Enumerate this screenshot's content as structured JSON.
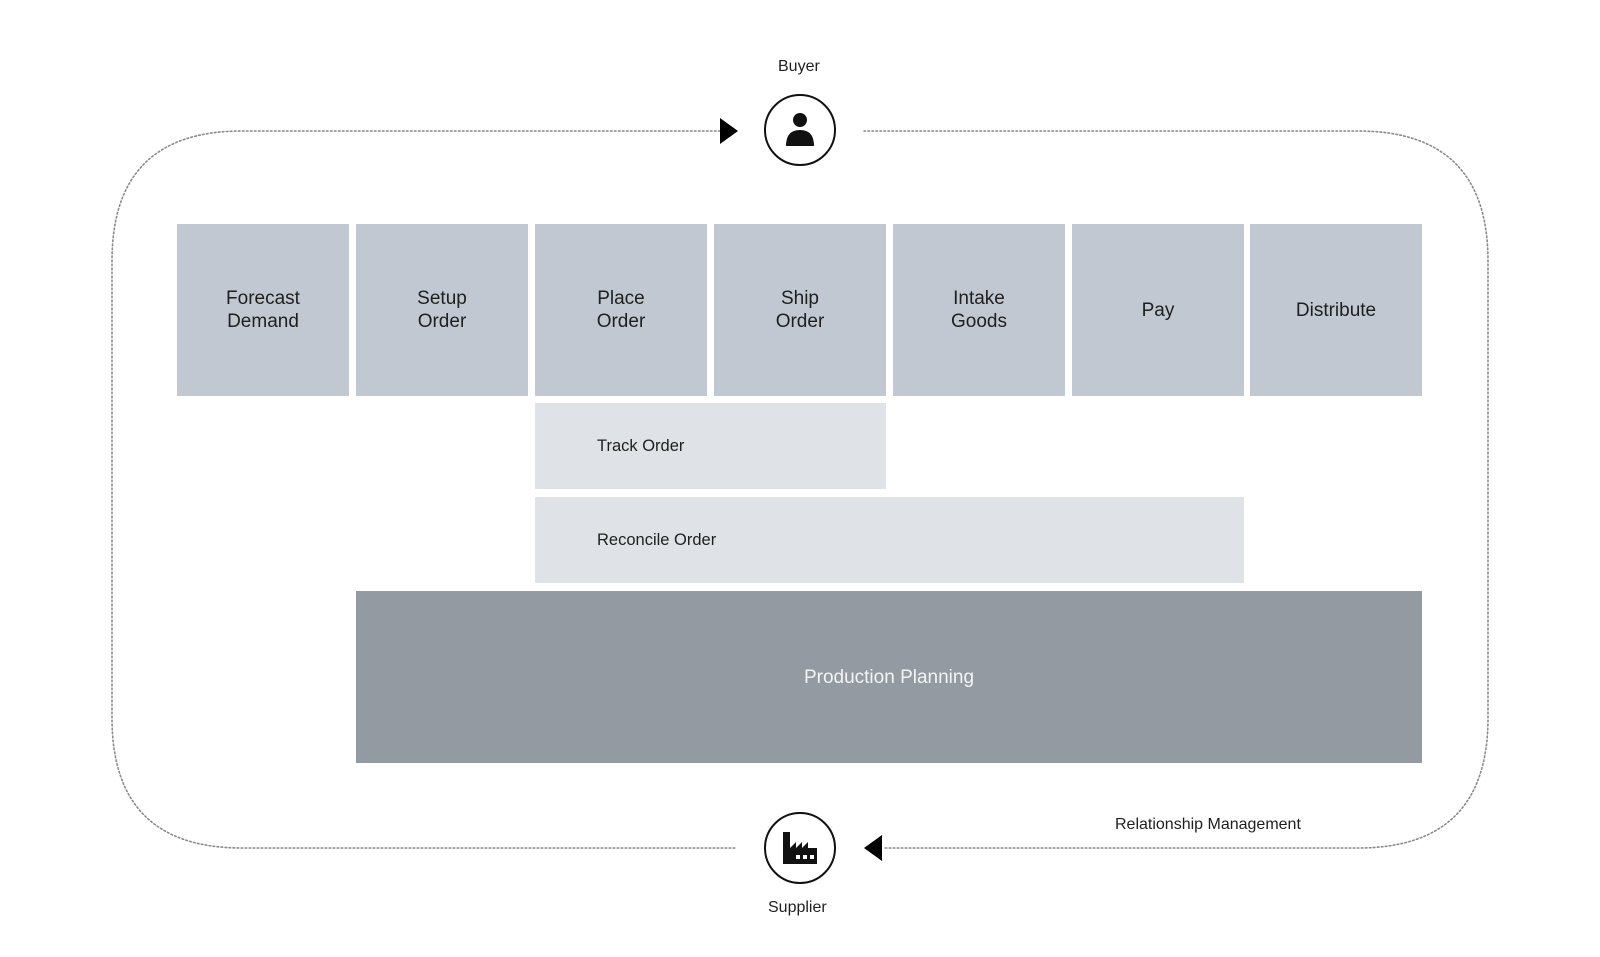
{
  "diagram": {
    "type": "supply-chain-process-map",
    "actors": {
      "buyer": {
        "label": "Buyer",
        "icon": "person-icon"
      },
      "supplier": {
        "label": "Supplier",
        "icon": "factory-icon"
      }
    },
    "cycle_label": "Relationship Management",
    "flow_direction": {
      "top": "toward buyer (left-to-right arrow)",
      "bottom": "toward supplier (right-to-left arrow)"
    },
    "stages": [
      {
        "label": "Forecast\nDemand"
      },
      {
        "label": "Setup\nOrder"
      },
      {
        "label": "Place\nOrder"
      },
      {
        "label": "Ship\nOrder"
      },
      {
        "label": "Intake\nGoods"
      },
      {
        "label": "Pay"
      },
      {
        "label": "Distribute"
      }
    ],
    "bands": [
      {
        "label": "Track Order",
        "spans_stages": [
          "Place Order",
          "Ship Order"
        ]
      },
      {
        "label": "Reconcile Order",
        "spans_stages": [
          "Place Order",
          "Ship Order",
          "Intake Goods",
          "Pay"
        ]
      }
    ],
    "base": {
      "label": "Production Planning",
      "spans_stages": [
        "Setup Order",
        "Place Order",
        "Ship Order",
        "Intake Goods",
        "Pay",
        "Distribute"
      ]
    },
    "colors": {
      "stage": "#c1c8d2",
      "band": "#dfe3e8",
      "base": "#949aa1",
      "base_text": "#f3f4f6",
      "outline": "#8a8a8a",
      "icon": "#111111"
    }
  }
}
